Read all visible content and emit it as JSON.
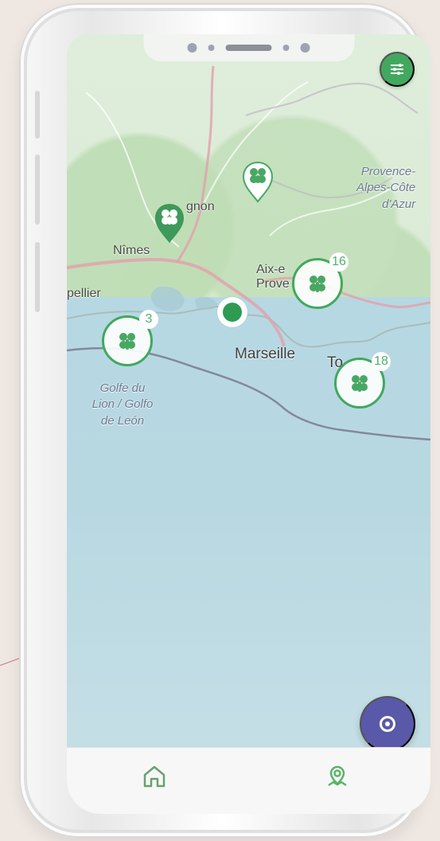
{
  "map": {
    "labels": {
      "provence": "Provence-\nAlpes-Côte\nd'Azur",
      "gignon": "gnon",
      "nimes": "Nîmes",
      "aix": "Aix-e\nProve",
      "pellier": "pellier",
      "marseille": "Marseille",
      "to": "To",
      "golfe": "Golfe du\nLion / Golfo\nde León"
    },
    "clusters": {
      "west": "3",
      "center": "16",
      "east": "18"
    }
  },
  "icons": {
    "filter": "filter-icon",
    "pin": "clover-pin-icon",
    "cluster": "clover-cluster-icon",
    "current_location": "current-location-icon",
    "locate": "locate-icon",
    "home": "home-icon",
    "map": "map-icon"
  },
  "colors": {
    "accent_green": "#43a85f",
    "accent_purple": "#5a58a8",
    "sea_blue": "#b8d8e1",
    "land_green": "#d9ead5"
  }
}
